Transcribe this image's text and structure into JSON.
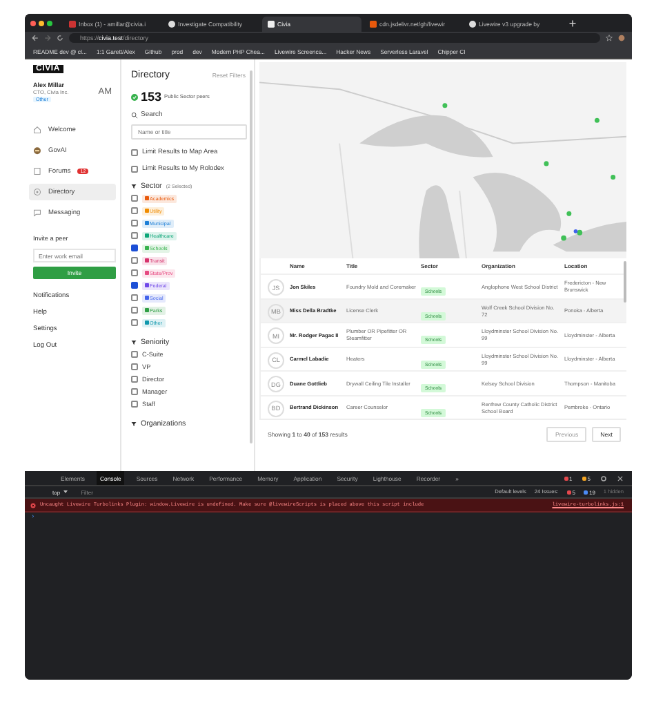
{
  "browser": {
    "tabs": [
      {
        "title": "Inbox (1) - amillar@civia.i",
        "selected": false
      },
      {
        "title": "Investigate Compatibility",
        "selected": false
      },
      {
        "title": "Civia",
        "selected": true
      },
      {
        "title": "cdn.jsdelivr.net/gh/livewir",
        "selected": false
      },
      {
        "title": "Livewire v3 upgrade by",
        "selected": false
      }
    ],
    "url": {
      "scheme": "https://",
      "host": "civia.test",
      "path": "/directory"
    },
    "bookmarks": [
      "README dev @ cl...",
      "1:1 Garett/Alex",
      "Github",
      "prod",
      "dev",
      "Modern PHP Chea...",
      "Livewire Screenca...",
      "Hacker News",
      "Serverless Laravel",
      "Chipper CI"
    ]
  },
  "sidebar": {
    "logo": "CIVIA",
    "user": {
      "name": "Alex Millar",
      "role": "CTO, Civia Inc.",
      "badge": "Other",
      "initials": "AM"
    },
    "nav": [
      {
        "label": "Welcome",
        "selected": false
      },
      {
        "label": "GovAI",
        "selected": false
      },
      {
        "label": "Forums",
        "selected": false,
        "badge": "12"
      },
      {
        "label": "Directory",
        "selected": true
      },
      {
        "label": "Messaging",
        "selected": false
      }
    ],
    "invite": {
      "title": "Invite a peer",
      "placeholder": "Enter work email",
      "button": "Invite"
    },
    "links": [
      "Notifications",
      "Help",
      "Settings",
      "Log Out"
    ]
  },
  "filters": {
    "title": "Directory",
    "reset": "Reset Filters",
    "count": "153",
    "count_label": "Public Sector peers",
    "search_label": "Search",
    "search_placeholder": "Name or title",
    "limits": [
      {
        "label": "Limit Results to Map Area",
        "checked": false
      },
      {
        "label": "Limit Results to My Rolodex",
        "checked": false
      }
    ],
    "sector": {
      "title": "Sector",
      "note": "(2 Selected)",
      "items": [
        {
          "label": "Academics",
          "checked": false,
          "color": "#e8590c"
        },
        {
          "label": "Utility",
          "checked": false,
          "color": "#f08c00"
        },
        {
          "label": "Municipal",
          "checked": false,
          "color": "#1c7ed6"
        },
        {
          "label": "Healthcare",
          "checked": false,
          "color": "#0ca678"
        },
        {
          "label": "Schools",
          "checked": true,
          "color": "#37b24d"
        },
        {
          "label": "Transit",
          "checked": false,
          "color": "#d6336c"
        },
        {
          "label": "State/Prov",
          "checked": false,
          "color": "#e64980"
        },
        {
          "label": "Federal",
          "checked": true,
          "color": "#7048e8"
        },
        {
          "label": "Social",
          "checked": false,
          "color": "#4263eb"
        },
        {
          "label": "Parks",
          "checked": false,
          "color": "#2f9e44"
        },
        {
          "label": "Other",
          "checked": false,
          "color": "#1098ad"
        }
      ]
    },
    "seniority": {
      "title": "Seniority",
      "items": [
        {
          "label": "C-Suite",
          "checked": false
        },
        {
          "label": "VP",
          "checked": false
        },
        {
          "label": "Director",
          "checked": false
        },
        {
          "label": "Manager",
          "checked": false
        },
        {
          "label": "Staff",
          "checked": false
        }
      ]
    },
    "organizations": {
      "title": "Organizations"
    }
  },
  "table": {
    "columns": [
      "Name",
      "Title",
      "Sector",
      "Organization",
      "Location"
    ],
    "rows": [
      {
        "initials": "JS",
        "name": "Jon Skiles",
        "title": "Foundry Mold and Coremaker",
        "sector": "Schools",
        "organization": "Anglophone West School District",
        "location": "Fredericton - New Brunswick",
        "selected": false
      },
      {
        "initials": "MB",
        "name": "Miss Della Bradtke",
        "title": "License Clerk",
        "sector": "Schools",
        "organization": "Wolf Creek School Division No. 72",
        "location": "Ponoka - Alberta",
        "selected": true
      },
      {
        "initials": "MI",
        "name": "Mr. Rodger Pagac II",
        "title": "Plumber OR Pipefitter OR Steamfitter",
        "sector": "Schools",
        "organization": "Lloydminster School Division No. 99",
        "location": "Lloydminster - Alberta",
        "selected": false
      },
      {
        "initials": "CL",
        "name": "Carmel Labadie",
        "title": "Heaters",
        "sector": "Schools",
        "organization": "Lloydminster School Division No. 99",
        "location": "Lloydminster - Alberta",
        "selected": false
      },
      {
        "initials": "DG",
        "name": "Duane Gottlieb",
        "title": "Drywall Ceiling Tile Installer",
        "sector": "Schools",
        "organization": "Kelsey School Division",
        "location": "Thompson - Manitoba",
        "selected": false
      },
      {
        "initials": "BD",
        "name": "Bertrand Dickinson",
        "title": "Career Counselor",
        "sector": "Schools",
        "organization": "Renfrew County Catholic District School Board",
        "location": "Pembroke - Ontario",
        "selected": false
      }
    ],
    "footer": "Showing **1** to **40** of **153** results",
    "buttons": [
      "Previous",
      "Next"
    ]
  },
  "devtools": {
    "tabs": [
      {
        "label": "Elements",
        "selected": false
      },
      {
        "label": "Console",
        "selected": true
      },
      {
        "label": "Sources",
        "selected": false
      },
      {
        "label": "Network",
        "selected": false
      },
      {
        "label": "Performance",
        "selected": false
      },
      {
        "label": "Memory",
        "selected": false
      },
      {
        "label": "Application",
        "selected": false
      },
      {
        "label": "Security",
        "selected": false
      },
      {
        "label": "Lighthouse",
        "selected": false
      },
      {
        "label": "Recorder",
        "selected": false
      },
      {
        "label": "»",
        "selected": false
      }
    ],
    "errors": "1",
    "warnings": "5",
    "context": "top",
    "filter_placeholder": "Filter",
    "levels": "Default levels",
    "issues_label": "24 Issues:",
    "issues_errors": "5",
    "issues_info": "19",
    "hidden": "1 hidden",
    "message": "Uncaught Livewire Turbolinks Plugin: window.Livewire is undefined. Make sure @livewireScripts is placed above this script include",
    "source": "livewire-turbolinks.js:1",
    "prompt": "›"
  }
}
